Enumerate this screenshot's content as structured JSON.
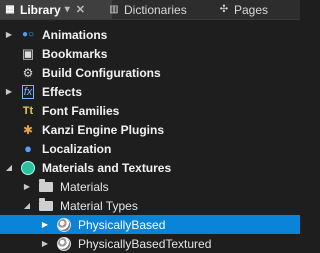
{
  "tabs": [
    {
      "label": "Library",
      "icon": "library-icon",
      "pin": "pin-icon",
      "close": "close-icon",
      "active": true
    },
    {
      "label": "Dictionaries",
      "icon": "dictionaries-icon",
      "active": false
    },
    {
      "label": "Pages",
      "icon": "pages-icon",
      "active": false
    }
  ],
  "tree": [
    {
      "label": "Animations",
      "icon": "animations-icon",
      "expand": "▶"
    },
    {
      "label": "Bookmarks",
      "icon": "bookmarks-icon",
      "expand": ""
    },
    {
      "label": "Build Configurations",
      "icon": "build-configurations-icon",
      "expand": ""
    },
    {
      "label": "Effects",
      "icon": "effects-icon",
      "expand": "▶"
    },
    {
      "label": "Font Families",
      "icon": "font-families-icon",
      "expand": ""
    },
    {
      "label": "Kanzi Engine Plugins",
      "icon": "plugins-icon",
      "expand": ""
    },
    {
      "label": "Localization",
      "icon": "localization-icon",
      "expand": ""
    },
    {
      "label": "Materials and Textures",
      "icon": "materials-textures-icon",
      "expand": "◢"
    },
    {
      "label": "Materials",
      "icon": "folder-icon",
      "expand": "▶"
    },
    {
      "label": "Material Types",
      "icon": "folder-icon",
      "expand": "◢"
    },
    {
      "label": "PhysicallyBased",
      "icon": "material-type-icon",
      "expand": "▶"
    },
    {
      "label": "PhysicallyBasedTextured",
      "icon": "material-type-icon",
      "expand": "▶"
    }
  ]
}
